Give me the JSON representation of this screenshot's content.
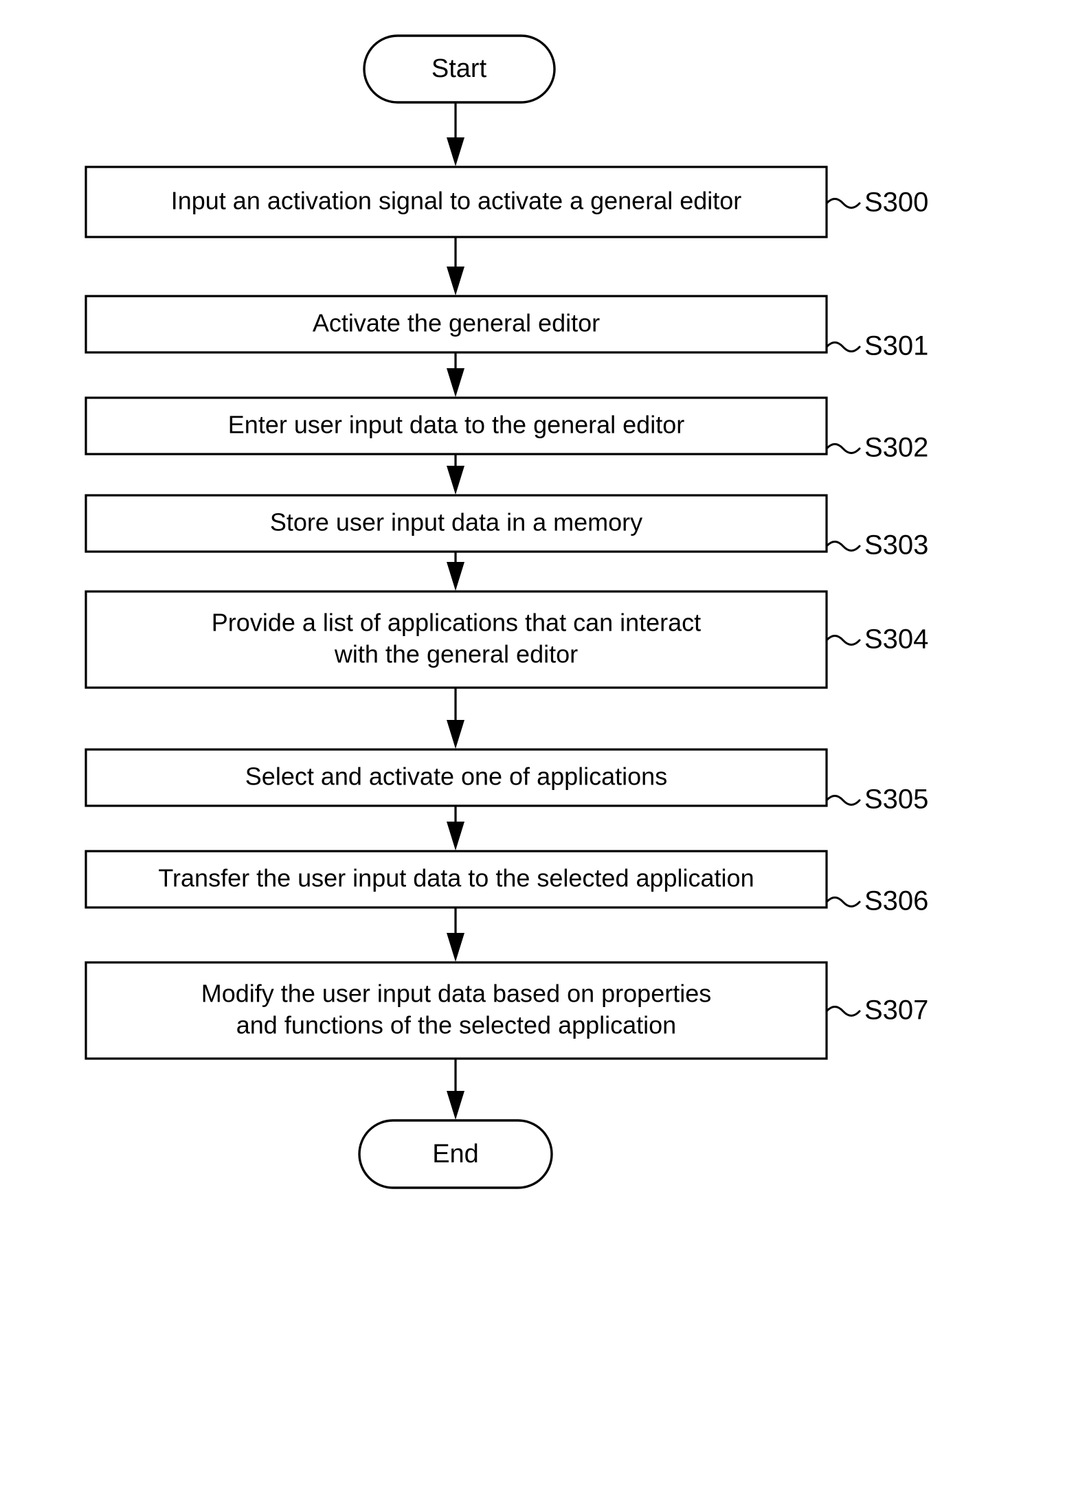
{
  "diagram": {
    "type": "flowchart",
    "orientation": "vertical",
    "background_color": "#ffffff",
    "line_color": "#000000",
    "start": {
      "label": "Start",
      "shape": "terminal-capsule"
    },
    "end": {
      "label": "End",
      "shape": "terminal-capsule"
    },
    "steps": [
      {
        "id": "S300",
        "ref": "S300",
        "lines": [
          "Input an activation signal to activate a general editor"
        ],
        "shape": "process-rectangle"
      },
      {
        "id": "S301",
        "ref": "S301",
        "lines": [
          "Activate the general editor"
        ],
        "shape": "process-rectangle"
      },
      {
        "id": "S302",
        "ref": "S302",
        "lines": [
          "Enter user input data to the general editor"
        ],
        "shape": "process-rectangle"
      },
      {
        "id": "S303",
        "ref": "S303",
        "lines": [
          "Store user input data in a memory"
        ],
        "shape": "process-rectangle"
      },
      {
        "id": "S304",
        "ref": "S304",
        "lines": [
          "Provide a list of applications that can interact",
          "with the general editor"
        ],
        "shape": "process-rectangle"
      },
      {
        "id": "S305",
        "ref": "S305",
        "lines": [
          "Select and activate one of applications"
        ],
        "shape": "process-rectangle"
      },
      {
        "id": "S306",
        "ref": "S306",
        "lines": [
          "Transfer the user input data to the selected application"
        ],
        "shape": "process-rectangle"
      },
      {
        "id": "S307",
        "ref": "S307",
        "lines": [
          "Modify the user input data based on properties",
          "and functions of the selected application"
        ],
        "shape": "process-rectangle"
      }
    ]
  }
}
